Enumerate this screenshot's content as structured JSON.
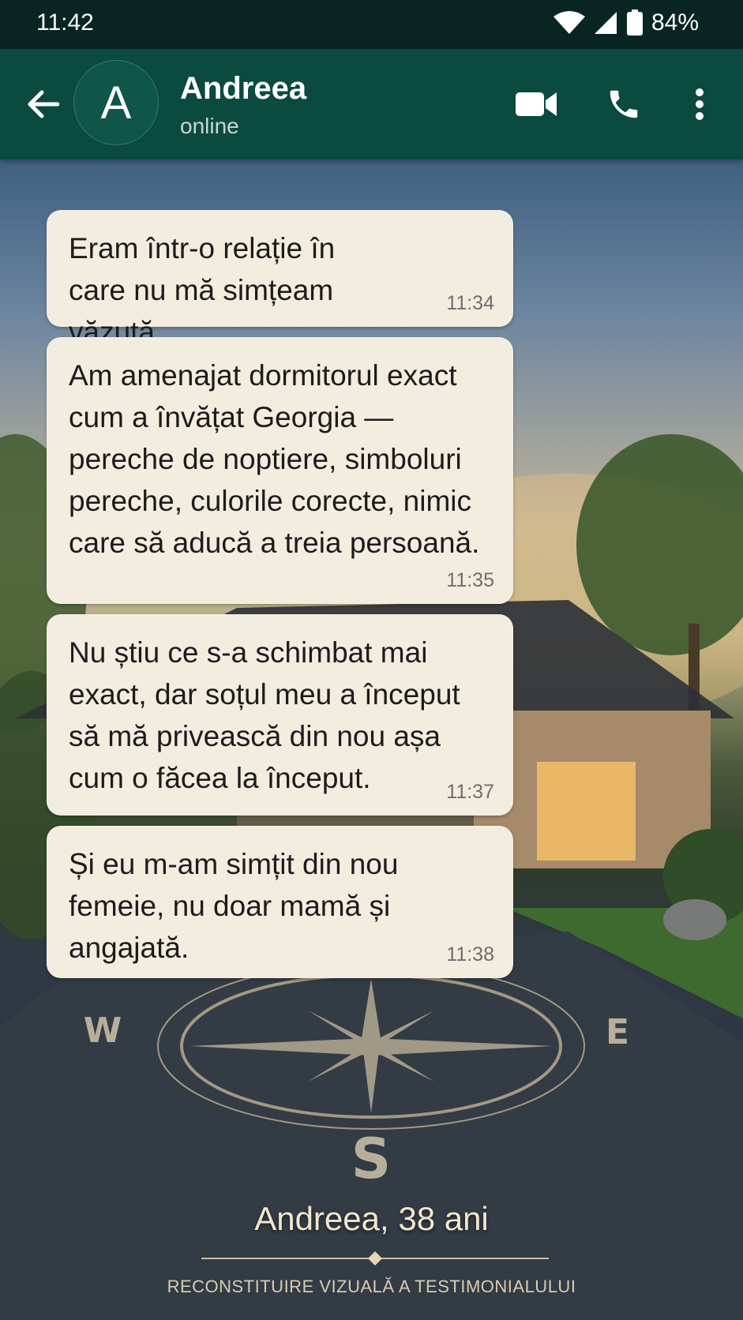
{
  "status_bar": {
    "time": "11:42",
    "battery": "84%"
  },
  "header": {
    "avatar_letter": "A",
    "contact_name": "Andreea",
    "contact_status": "online"
  },
  "messages": [
    {
      "text": "Eram într-o relație în care nu mă simțeam văzută.",
      "time": "11:34"
    },
    {
      "text": "Am amenajat dormitorul exact cum a învățat Georgia — pereche de noptiere, simboluri pereche, culorile corecte, nimic care să aducă a treia persoană.",
      "time": "11:35"
    },
    {
      "text": "Nu știu ce s-a schimbat mai exact, dar soțul meu a început să mă privească din nou așa cum o făcea la început.",
      "time": "11:37"
    },
    {
      "text": "Și eu m-am simțit din nou femeie, nu doar mamă și angajată.",
      "time": "11:38"
    }
  ],
  "compass_letters": {
    "west": "W",
    "east": "E",
    "south": "S"
  },
  "caption": {
    "name": "Andreea, 38 ani",
    "subtitle": "RECONSTITUIRE VIZUALĂ A TESTIMONIALULUI"
  },
  "colors": {
    "header": "#0b4a3f",
    "statusbar": "#082522",
    "bubble": "#f3ede0",
    "caption": "#f2e7cc"
  }
}
